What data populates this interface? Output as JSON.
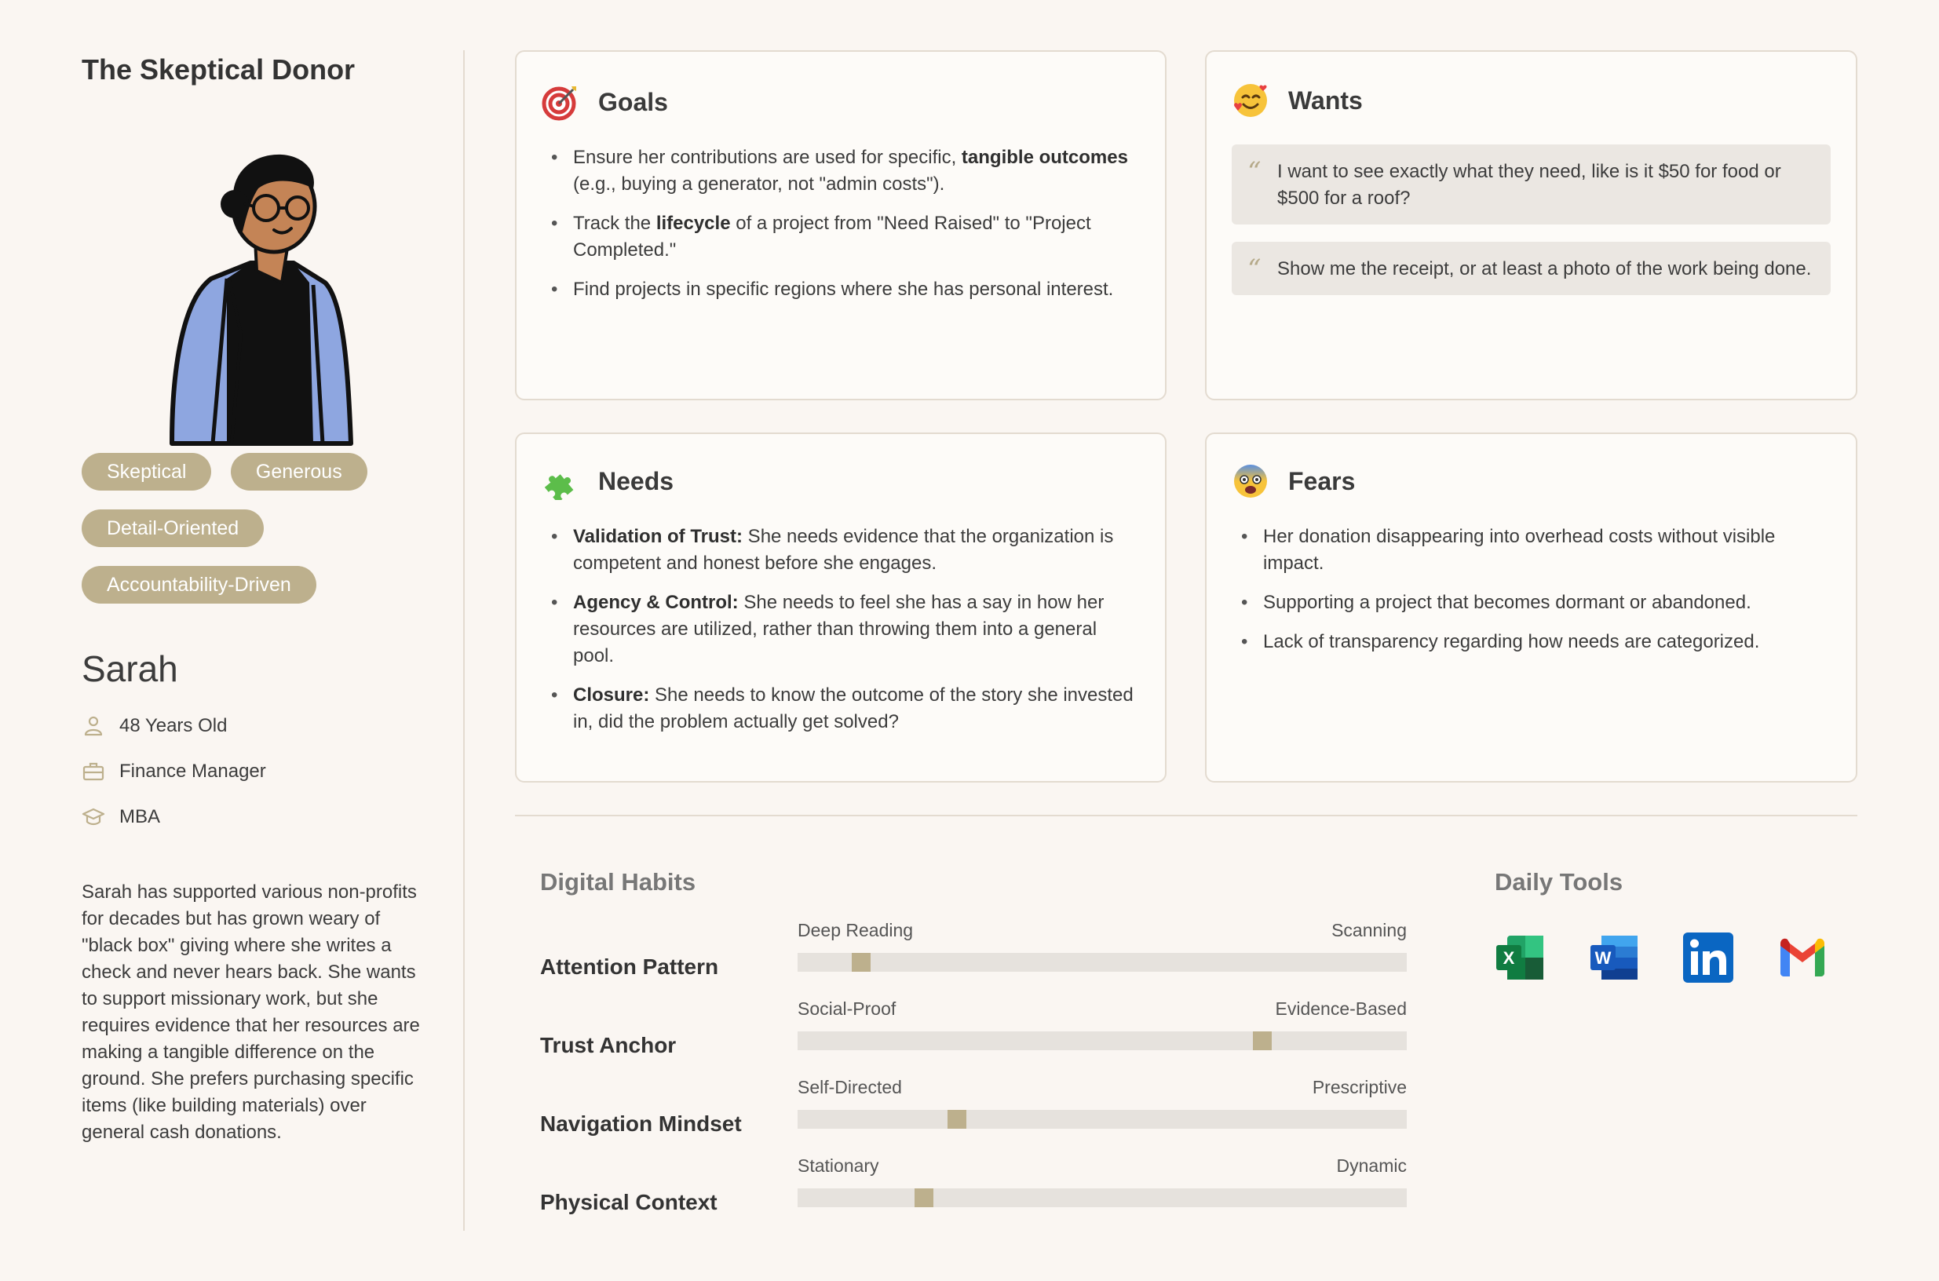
{
  "persona": {
    "title": "The Skeptical Donor",
    "tags": [
      "Skeptical",
      "Generous",
      "Detail-Oriented",
      "Accountability-Driven"
    ],
    "name": "Sarah",
    "age": "48 Years Old",
    "job": "Finance Manager",
    "education": "MBA",
    "bio": "Sarah has supported various non-profits for decades but has grown weary of \"black box\" giving where she writes a check and never hears back. She wants to support missionary work, but she requires evidence that her resources are making a tangible difference on the ground. She prefers purchasing specific items (like building materials) over general cash donations."
  },
  "goals": {
    "title": "Goals",
    "icon": "target-icon",
    "items": [
      {
        "pre": "Ensure her contributions are used for specific, ",
        "bold": "tangible outcomes",
        "post": " (e.g., buying a generator, not \"admin costs\")."
      },
      {
        "pre": "Track the ",
        "bold": "lifecycle",
        "post": " of a project from \"Need Raised\" to \"Project Completed.\""
      },
      {
        "pre": "Find projects in specific regions where she has personal interest.",
        "bold": "",
        "post": ""
      }
    ]
  },
  "wants": {
    "title": "Wants",
    "icon": "smiling-face-with-hearts-icon",
    "quotes": [
      "I want to see exactly what they need, like is it $50 for food or $500 for a roof?",
      "Show me the receipt, or at least a photo of the work being done."
    ]
  },
  "needs": {
    "title": "Needs",
    "icon": "puzzle-piece-icon",
    "items": [
      {
        "bold": "Validation of Trust:",
        "text": " She needs evidence that the organization is competent and honest before she engages."
      },
      {
        "bold": "Agency & Control:",
        "text": " She needs to feel she has a say in how her resources are utilized, rather than throwing them into a general pool."
      },
      {
        "bold": "Closure:",
        "text": " She needs to know the outcome of the story she invested in, did the problem actually get solved?"
      }
    ]
  },
  "fears": {
    "title": "Fears",
    "icon": "fearful-face-icon",
    "items": [
      "Her donation disappearing into overhead costs without visible impact.",
      "Supporting a project that becomes dormant or abandoned.",
      "Lack of transparency regarding how needs are categorized."
    ]
  },
  "digital_habits": {
    "title": "Digital Habits",
    "habits": [
      {
        "label": "Attention Pattern",
        "left": "Deep Reading",
        "right": "Scanning",
        "value": 0.105
      },
      {
        "label": "Trust Anchor",
        "left": "Social-Proof",
        "right": "Evidence-Based",
        "value": 0.763
      },
      {
        "label": "Navigation Mindset",
        "left": "Self-Directed",
        "right": "Prescriptive",
        "value": 0.262
      },
      {
        "label": "Physical Context",
        "left": "Stationary",
        "right": "Dynamic",
        "value": 0.207
      }
    ]
  },
  "daily_tools": {
    "title": "Daily Tools",
    "tools": [
      "excel-icon",
      "word-icon",
      "linkedin-icon",
      "gmail-icon"
    ]
  },
  "colors": {
    "accent": "#bdb08d",
    "background": "#faf6f2",
    "card": "#fdfbf8",
    "border": "#e3dbd0",
    "quote_bg": "#ebe7e2"
  }
}
